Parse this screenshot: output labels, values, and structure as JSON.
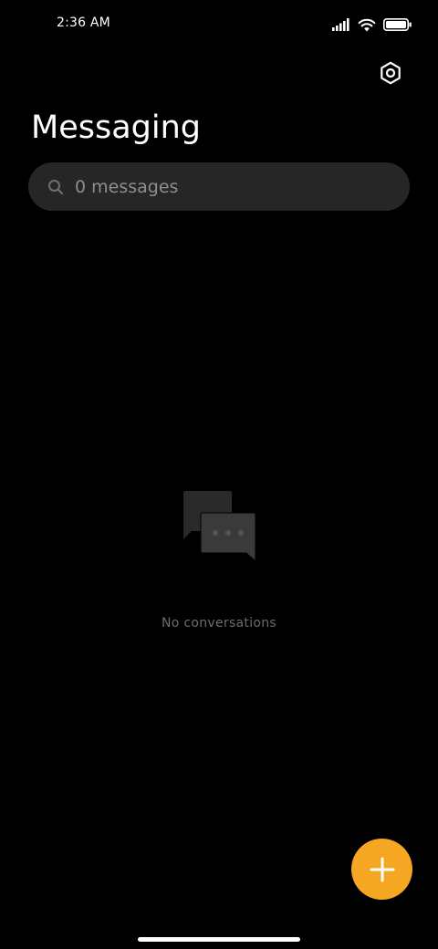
{
  "status_bar": {
    "time": "2:36 AM",
    "icons": [
      "signal-icon",
      "wifi-icon",
      "battery-icon"
    ]
  },
  "header": {
    "title": "Messaging",
    "settings_icon": "gear-icon"
  },
  "search": {
    "placeholder": "0 messages",
    "icon": "search-icon"
  },
  "empty_state": {
    "icon": "chat-bubbles-icon",
    "text": "No conversations"
  },
  "fab": {
    "icon": "plus-icon",
    "color": "#f5a623"
  },
  "colors": {
    "background": "#000000",
    "search_bg": "#262626",
    "accent": "#f5a623",
    "muted_text": "#6b6b6b"
  }
}
